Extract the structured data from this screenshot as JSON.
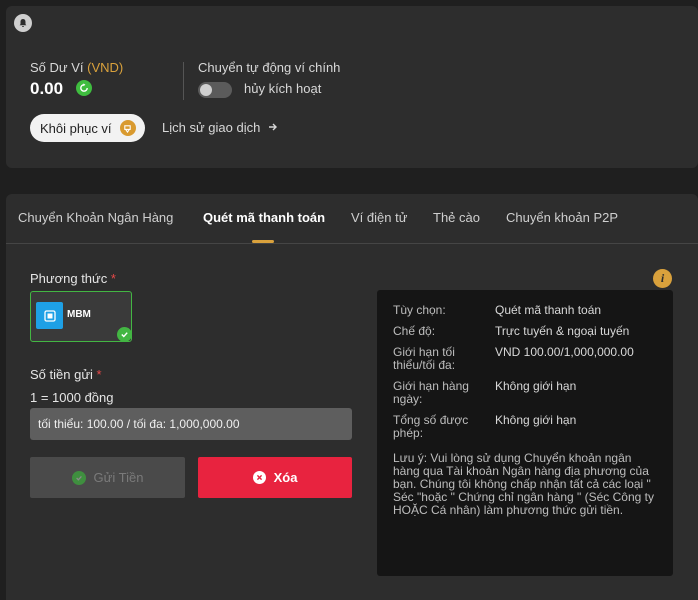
{
  "wallet": {
    "balance_label": "Số Dư Ví",
    "currency_label": "(VND)",
    "balance_value": "0.00",
    "auto_transfer_label": "Chuyển tự động ví chính",
    "toggle_state_label": "hủy kích hoạt",
    "toggle_on": false,
    "restore_button": "Khôi phục ví",
    "history_link": "Lịch sử giao dịch"
  },
  "tabs": [
    {
      "label": "Chuyển Khoản Ngân Hàng",
      "active": false
    },
    {
      "label": "Quét mã thanh toán",
      "active": true
    },
    {
      "label": "Ví điện tử",
      "active": false
    },
    {
      "label": "Thẻ cào",
      "active": false
    },
    {
      "label": "Chuyển khoản P2P",
      "active": false
    }
  ],
  "form": {
    "method_label": "Phương thức",
    "required_mark": "*",
    "method_option": "MBM",
    "amount_label": "Số tiền gửi",
    "rate_text": "1 = 1000 đồng",
    "amount_placeholder": "tối thiểu: 100.00 / tối đa: 1,000,000.00",
    "submit_button": "Gửi Tiền",
    "clear_button": "Xóa"
  },
  "info": {
    "rows": [
      {
        "key": "Tùy chọn:",
        "value": "Quét mã thanh toán"
      },
      {
        "key": "Chế độ:",
        "value": "Trực tuyến & ngoại tuyến"
      },
      {
        "key": "Giới hạn tối thiểu/tối đa:",
        "value": "VND 100.00/1,000,000.00"
      },
      {
        "key": "Giới hạn hàng ngày:",
        "value": "Không giới hạn"
      },
      {
        "key": "Tổng số được phép:",
        "value": "Không giới hạn"
      }
    ],
    "note": "Lưu ý: Vui lòng sử dụng Chuyển khoản ngân hàng qua Tài khoản Ngân hàng địa phương của bạn. Chúng tôi không chấp nhận tất cả các loại \" Séc \"hoặc \" Chứng chỉ ngân hàng \" (Séc Công ty HOẶC Cá nhân) làm phương thức gửi tiền."
  },
  "colors": {
    "accent": "#d9a13c",
    "success": "#43b643",
    "danger": "#e8233f"
  }
}
